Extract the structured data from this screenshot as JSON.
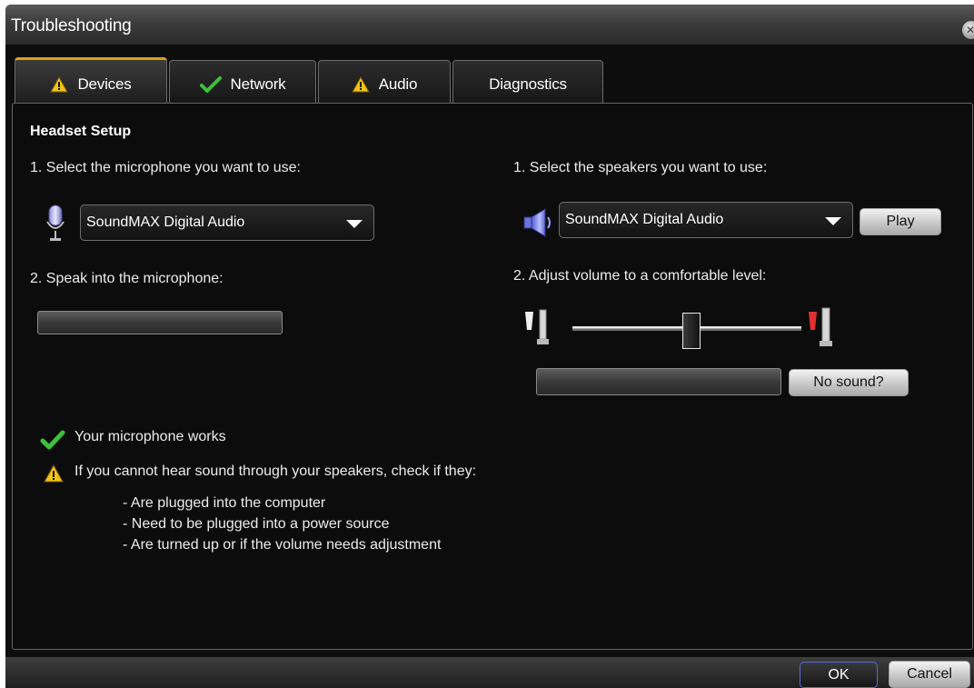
{
  "window": {
    "title": "Troubleshooting",
    "close_icon": "close-icon"
  },
  "tabs": [
    {
      "label": "Devices",
      "icon": "warning-icon",
      "active": true
    },
    {
      "label": "Network",
      "icon": "check-icon",
      "active": false
    },
    {
      "label": "Audio",
      "icon": "warning-icon",
      "active": false
    },
    {
      "label": "Diagnostics",
      "icon": null,
      "active": false
    }
  ],
  "devices": {
    "section_title": "Headset Setup",
    "microphone": {
      "select_label": "1. Select the microphone you want to use:",
      "icon": "microphone-icon",
      "selected": "SoundMAX Digital Audio",
      "speak_label": "2. Speak into the microphone:",
      "level": 0
    },
    "speakers": {
      "select_label": "1. Select the speakers you want to use:",
      "icon": "speaker-icon",
      "selected": "SoundMAX Digital Audio",
      "play_label": "Play",
      "volume_label": "2. Adjust volume to a comfortable level:",
      "volume_low_icon": "volume-low-icon",
      "volume_high_icon": "volume-high-icon",
      "volume_level": 0.52,
      "output_level": 0,
      "no_sound_label": "No sound?"
    },
    "status": {
      "mic_works": "Your microphone works",
      "mic_works_icon": "check-icon",
      "speaker_warning": "If you cannot hear sound through your speakers, check if they:",
      "speaker_warning_icon": "warning-icon",
      "checklist": [
        "- Are plugged into the computer",
        "- Need to be plugged into a power source",
        "- Are turned up or if the volume needs adjustment"
      ]
    }
  },
  "footer": {
    "ok_label": "OK",
    "cancel_label": "Cancel"
  },
  "colors": {
    "window_bg": "#0d0d0d",
    "warning": "#f2c318",
    "check": "#3cc23a",
    "accent_tab": "#d9a21a"
  }
}
